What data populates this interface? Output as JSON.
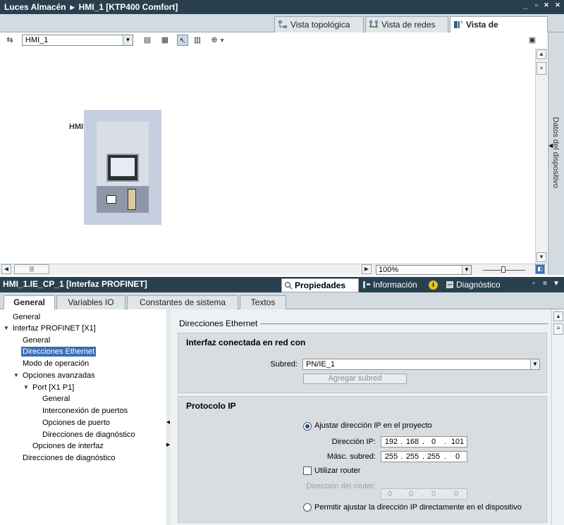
{
  "window": {
    "project": "Luces Almacén",
    "device": "HMI_1 [KTP400 Comfort]",
    "controls": {
      "minimize": "_",
      "restore": "▫",
      "close": "✕"
    }
  },
  "view_tabs": [
    "Vista topológica",
    "Vista de redes",
    "Vista de dispositivos"
  ],
  "toolbar": {
    "device_select": "HMI_1"
  },
  "canvas": {
    "device_label": "HMI",
    "zoom": "100%"
  },
  "side_panel": {
    "label": "Datos del dispositivo"
  },
  "properties": {
    "title": "HMI_1.IE_CP_1 [Interfaz PROFINET]",
    "tabs": [
      "Propiedades",
      "Información",
      "Diagnóstico"
    ],
    "subtabs": [
      "General",
      "Variables IO",
      "Constantes de sistema",
      "Textos"
    ]
  },
  "nav": {
    "general": "General",
    "interfaz": "Interfaz PROFINET [X1]",
    "interfaz_general": "General",
    "direcciones_ethernet": "Direcciones Ethernet",
    "modo_operacion": "Modo de operación",
    "opciones_avanzadas": "Opciones avanzadas",
    "port": "Port [X1 P1]",
    "port_general": "General",
    "interconexion": "Interconexión de puertos",
    "opciones_puerto": "Opciones de puerto",
    "dir_diagnostico_port": "Direcciones de diagnóstico",
    "opciones_interfaz": "Opciones de interfaz",
    "dir_diagnostico": "Direcciones de diagnóstico"
  },
  "content": {
    "section_title": "Direcciones Ethernet",
    "network": {
      "title": "Interfaz conectada en red con",
      "subnet_label": "Subred:",
      "subnet_value": "PN/IE_1",
      "add_subnet": "Agregar subred"
    },
    "ip": {
      "title": "Protocolo IP",
      "set_in_project": "Ajustar dirección IP en el proyecto",
      "ip_label": "Dirección IP:",
      "ip_value": [
        "192",
        "168",
        "0",
        "101"
      ],
      "mask_label": "Másc. subred:",
      "mask_value": [
        "255",
        "255",
        "255",
        "0"
      ],
      "use_router": "Utilizar router",
      "router_label": "Dirección del router:",
      "router_value": [
        "0",
        "0",
        "0",
        "0"
      ],
      "allow_device": "Permitir ajustar la dirección IP directamente en el dispositivo"
    }
  },
  "colors": {
    "header_bg": "#29414f",
    "selection": "#3c6fb5",
    "panel_bg": "#d3dbe0"
  }
}
